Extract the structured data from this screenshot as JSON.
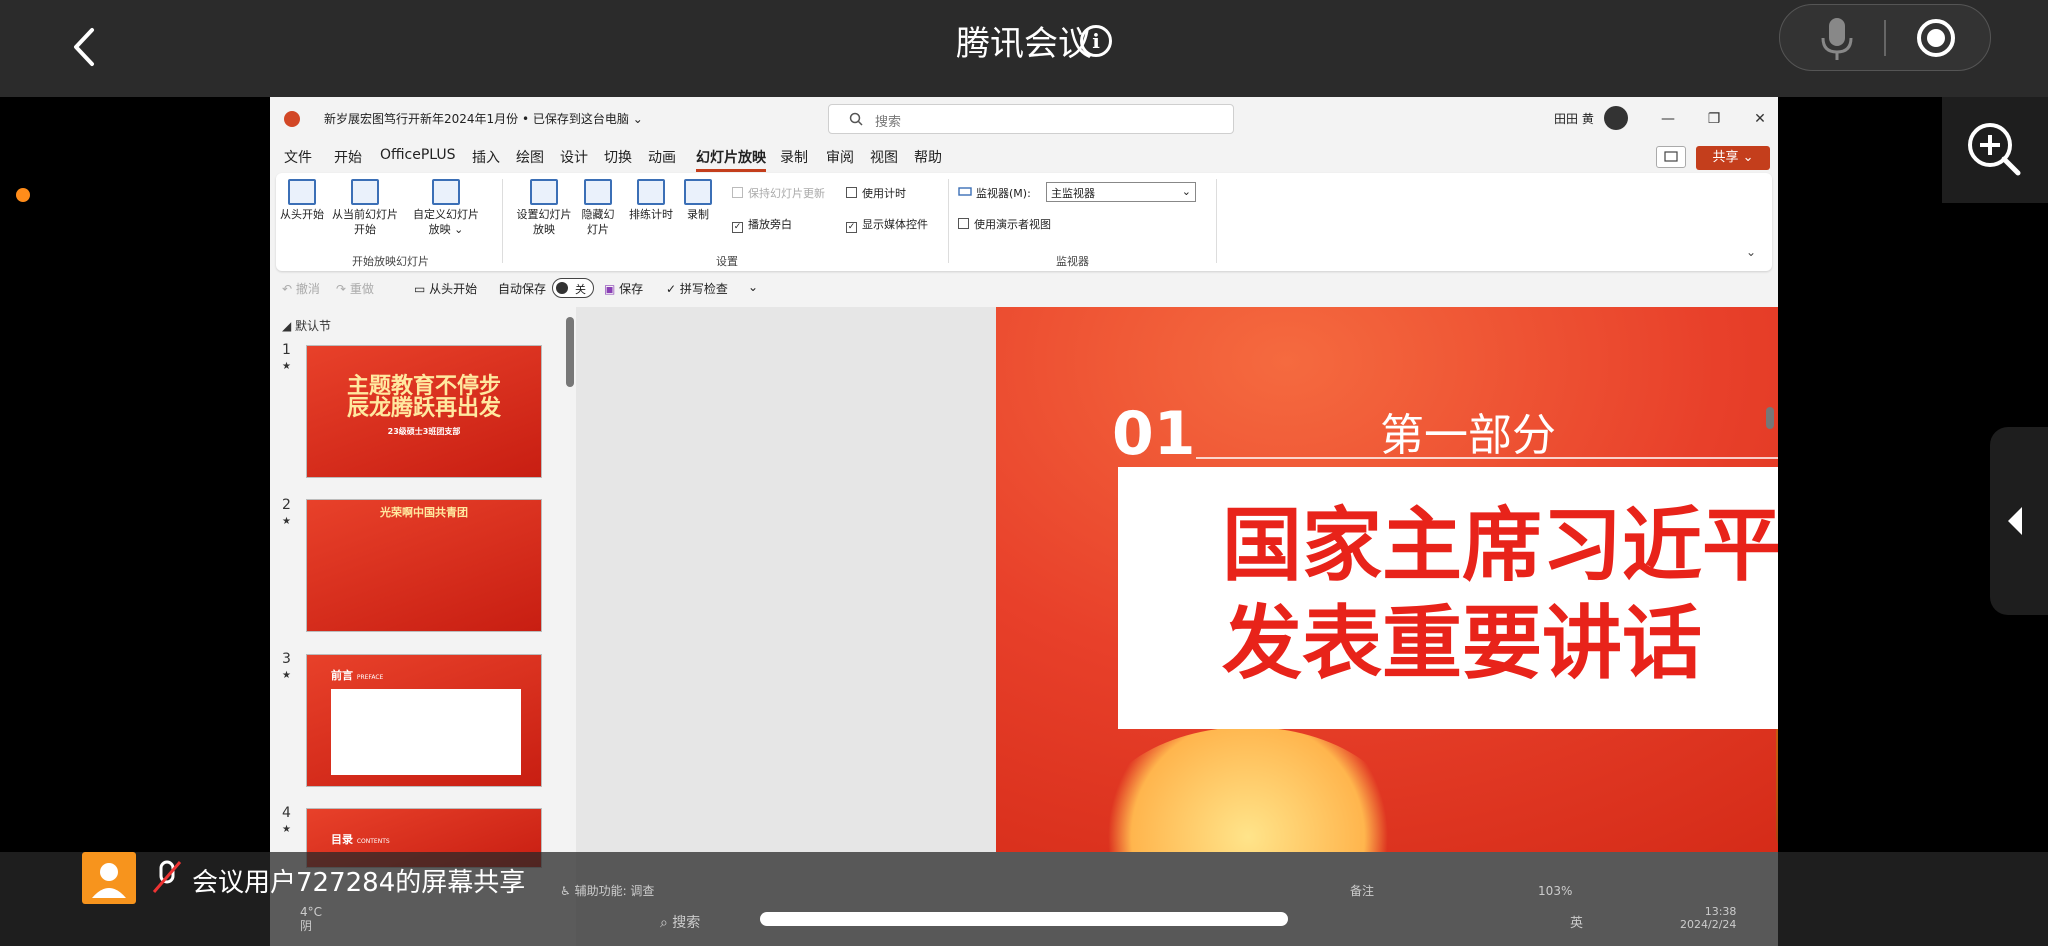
{
  "app": {
    "title": "腾讯会议"
  },
  "ppt": {
    "filename": "新岁展宏图笃行开新年2024年1月份 • 已保存到这台电脑 ⌄",
    "search_placeholder": "搜索",
    "user_name": "田田 黄",
    "tabs": [
      "文件",
      "开始",
      "OfficePLUS",
      "插入",
      "绘图",
      "设计",
      "切换",
      "动画",
      "幻灯片放映",
      "录制",
      "审阅",
      "视图",
      "帮助"
    ],
    "active_tab": "幻灯片放映",
    "share_label": "共享 ⌄",
    "ribbon": {
      "from_start": "从头开始",
      "from_current": "从当前幻灯片开始",
      "custom_show": "自定义幻灯片放映 ⌄",
      "group1_label": "开始放映幻灯片",
      "setup_show": "设置幻灯片放映",
      "hide_slide": "隐藏幻灯片",
      "rehearse": "排练计时",
      "record": "录制",
      "keep_updated": "保持幻灯片更新",
      "use_timings": "使用计时",
      "play_narration": "播放旁白",
      "show_media": "显示媒体控件",
      "group2_label": "设置",
      "monitor_label": "监视器(M):",
      "monitor_value": "主监视器",
      "presenter_view": "使用演示者视图",
      "group3_label": "监视器"
    },
    "qat": {
      "undo": "撤消",
      "redo": "重做",
      "from_start": "从头开始",
      "autosave": "自动保存",
      "autosave_state": "关",
      "save": "保存",
      "spellcheck": "拼写检查"
    },
    "thumbnails": {
      "section": "默认节",
      "slides": [
        {
          "num": "1",
          "text": "主题教育不停步\n辰龙腾跃再出发",
          "sub": "23级硕士3班团支部"
        },
        {
          "num": "2",
          "text": "光荣啊中国共青团",
          "sub": ""
        },
        {
          "num": "3",
          "text": "前言",
          "sub": "PREFACE"
        },
        {
          "num": "4",
          "text": "目录",
          "sub": "CONTENTS"
        }
      ]
    },
    "slide": {
      "number": "01",
      "part": "第一部分",
      "title_line1": "国家主席习近平",
      "title_line2": "发表重要讲话"
    },
    "status": {
      "accessibility": "辅助功能: 调查",
      "notes": "备注",
      "zoom": "103%"
    }
  },
  "overlay": {
    "share_text": "会议用户727284的屏幕共享"
  },
  "taskbar": {
    "weather_temp": "4°C",
    "weather_desc": "阴",
    "search": "搜索",
    "ime": "英",
    "time": "13:38",
    "date": "2024/2/24"
  },
  "colors": {
    "accent": "#c43e1c",
    "topbar": "#2b2b2b",
    "slide_red": "#e8402a",
    "title_red": "#e8231a",
    "dot_orange": "#ff8c1a"
  }
}
